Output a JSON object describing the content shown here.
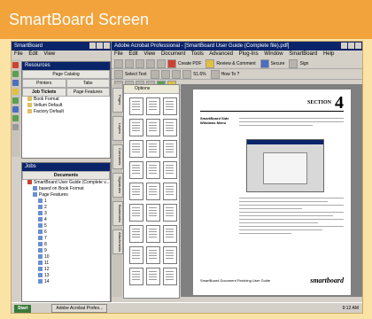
{
  "caption": "SmartBoard Screen",
  "left_window": {
    "title": "SmartBoard",
    "menu": [
      "File",
      "Edit",
      "View"
    ],
    "resources_panel": {
      "title": "Resources",
      "tabs_row1": [
        "Page Catalog"
      ],
      "tabs_row2": [
        "Printers",
        "Tabs"
      ],
      "tabs_row3": [
        "Job Tickets",
        "Page Features"
      ],
      "items": [
        "Book Format",
        "Vellum Default",
        "Factory Default"
      ]
    },
    "jobs_panel": {
      "title": "Jobs",
      "header": "Documents",
      "items": [
        "SmartBoard User Guide (Complete v...",
        "based on Book Format",
        "Page Features",
        "1",
        "2",
        "3",
        "4",
        "5",
        "6",
        "7",
        "8",
        "9",
        "10",
        "11",
        "12",
        "13",
        "14"
      ]
    }
  },
  "main_window": {
    "title": "Adobe Acrobat Professional - [SmartBoard User Guide (Complete file).pdf]",
    "menu": [
      "File",
      "Edit",
      "View",
      "Document",
      "Tools",
      "Advanced",
      "Plug-Ins",
      "Window",
      "SmartBoard",
      "Help"
    ],
    "toolbar1": [
      "Create PDF",
      "Review & Comment",
      "Secure",
      "Sign"
    ],
    "toolbar2": [
      "Select Text",
      "51.6%",
      "How To ?"
    ],
    "side_tabs": [
      "Pages",
      "Layers",
      "Comments",
      "Signatures",
      "Bookmarks",
      "Attachments"
    ],
    "thumbs_header": "Options",
    "thumb_count": 27,
    "document": {
      "section_word": "SECTION",
      "section_number": "4",
      "side_title": "SmartBoard Side Windows Menu",
      "footer_left": "SmartBoard Document Finishing User Guide",
      "footer_logo": "smartboard"
    }
  },
  "taskbar": {
    "start": "Start",
    "task": "Adobe Acrobat Profes...",
    "tray": "9:12 AM"
  }
}
